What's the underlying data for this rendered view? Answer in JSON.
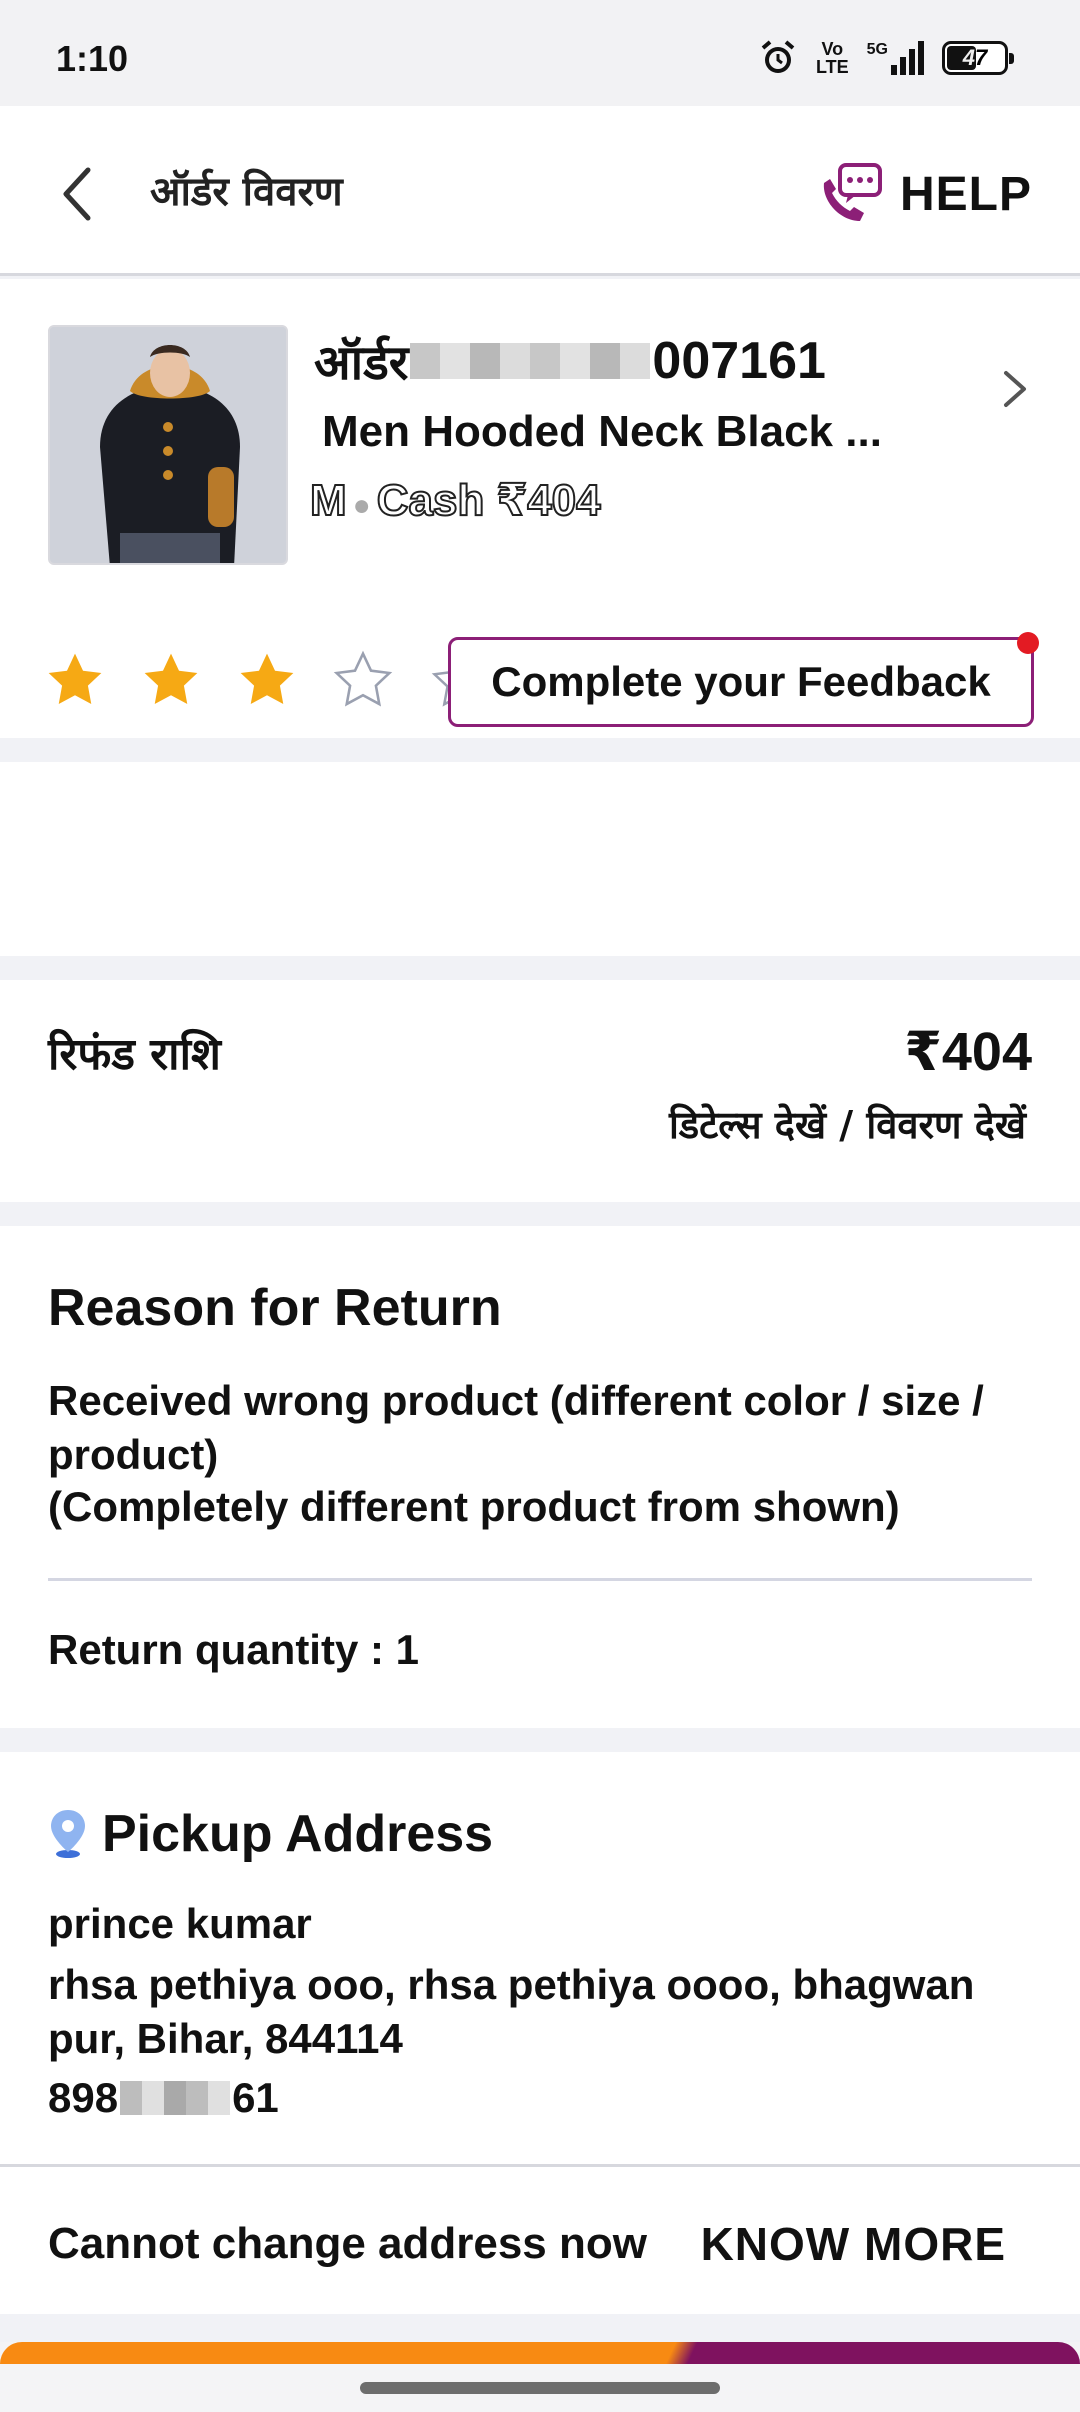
{
  "status_bar": {
    "time": "1:10",
    "volte_top": "Vo",
    "volte_bottom": "LTE",
    "network": "5G",
    "battery": "47"
  },
  "header": {
    "title": "ऑर्डर विवरण",
    "help_label": "HELP",
    "accent_color": "#8c1f77"
  },
  "order": {
    "id_prefix": "ऑर्डर",
    "id_suffix": "007161",
    "product_name": "Men Hooded Neck Black ...",
    "size": "M",
    "payment": "Cash ₹404",
    "rating": 3,
    "rating_max": 5,
    "feedback_label": "Complete your Feedback"
  },
  "refund": {
    "label": "रिफंड राशि",
    "amount": "₹404",
    "details_link": "डिटेल्स देखें / विवरण देखें"
  },
  "reason": {
    "title": "Reason for Return",
    "line1": "Received wrong product (different color / size / product)",
    "line2": "(Completely different product from shown)",
    "quantity": "Return quantity : 1"
  },
  "pickup": {
    "title": "Pickup Address",
    "name": "prince kumar",
    "address": "rhsa pethiya ooo, rhsa pethiya oooo, bhagwan pur, Bihar, 844114",
    "phone_prefix": "898",
    "phone_suffix": "61"
  },
  "footer": {
    "change_text": "Cannot change address now",
    "know_more": "KNOW MORE"
  }
}
